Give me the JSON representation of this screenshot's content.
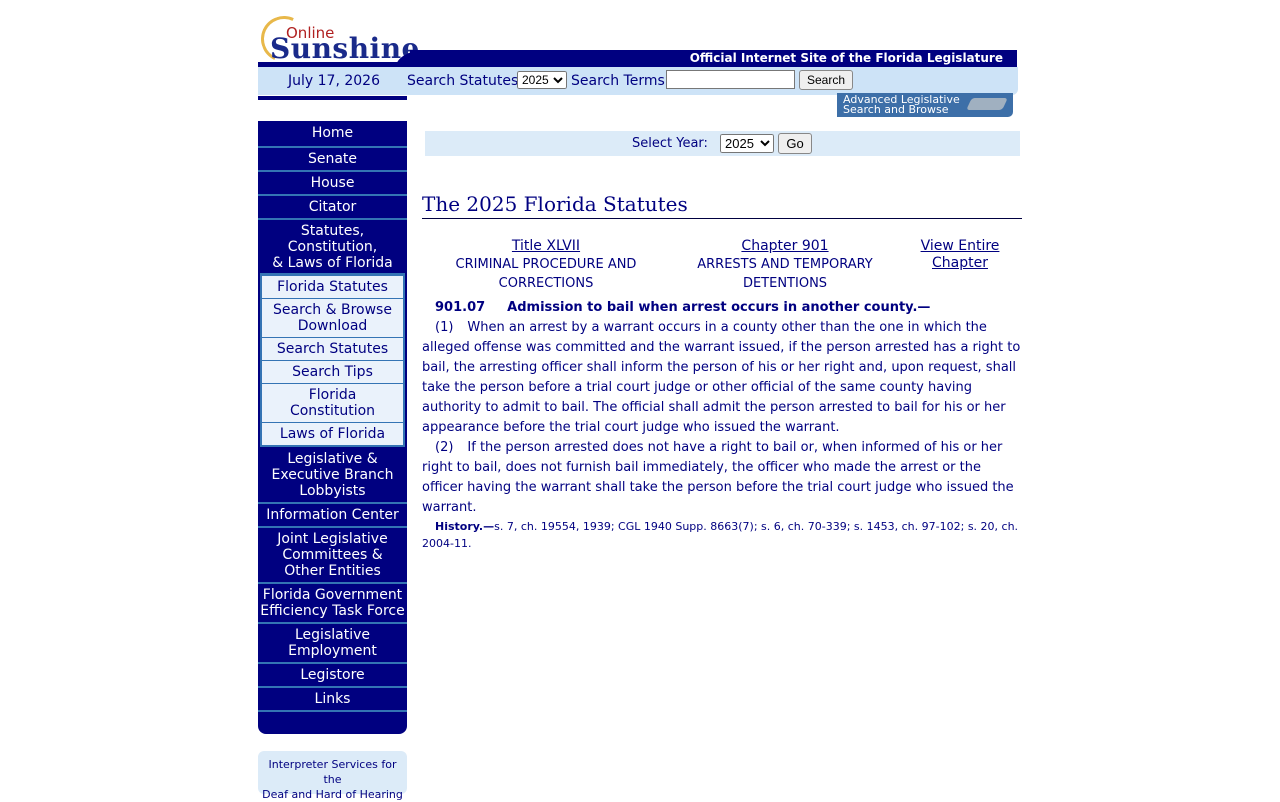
{
  "header": {
    "logo_top": "Online",
    "logo_main": "Sunshine",
    "banner": "Official Internet Site of the Florida Legislature",
    "date": "July 17, 2026",
    "search_statutes_label": "Search Statutes:",
    "search_year": "2025",
    "search_terms_label": "Search Terms:",
    "search_terms_value": "",
    "search_button": "Search",
    "advanced_line1": "Advanced Legislative",
    "advanced_line2": "Search and Browse"
  },
  "nav": {
    "items_top": [
      {
        "label": "Home"
      },
      {
        "label": "Senate"
      },
      {
        "label": "House"
      },
      {
        "label": "Citator"
      }
    ],
    "statutes_lines": [
      "Statutes,",
      "Constitution,",
      "& Laws of Florida"
    ],
    "sub_items": [
      {
        "lines": [
          "Florida Statutes"
        ]
      },
      {
        "lines": [
          "Search & Browse",
          "Download"
        ]
      },
      {
        "lines": [
          "Search Statutes"
        ]
      },
      {
        "lines": [
          "Search Tips"
        ]
      },
      {
        "lines": [
          "Florida",
          "Constitution"
        ]
      },
      {
        "lines": [
          "Laws of Florida"
        ]
      }
    ],
    "items_bottom": [
      {
        "lines": [
          "Legislative &",
          "Executive Branch",
          "Lobbyists"
        ]
      },
      {
        "lines": [
          "Information Center"
        ]
      },
      {
        "lines": [
          "Joint Legislative",
          "Committees &",
          "Other Entities"
        ]
      },
      {
        "lines": [
          "Florida Government",
          "Efficiency Task Force"
        ]
      },
      {
        "lines": [
          "Legislative",
          "Employment"
        ]
      },
      {
        "lines": [
          "Legistore"
        ]
      },
      {
        "lines": [
          "Links"
        ]
      }
    ]
  },
  "interpreter": {
    "line1": "Interpreter Services for the",
    "line2": "Deaf and Hard of Hearing"
  },
  "year_select": {
    "label": "Select Year:",
    "value": "2025",
    "go": "Go"
  },
  "page_title": "The 2025 Florida Statutes",
  "breadcrumbs": {
    "title_link": "Title XLVII",
    "title_desc_1": "CRIMINAL PROCEDURE AND",
    "title_desc_2": "CORRECTIONS",
    "chapter_link": "Chapter 901",
    "chapter_desc_1": "ARRESTS AND TEMPORARY",
    "chapter_desc_2": "DETENTIONS",
    "view_1": "View Entire",
    "view_2": "Chapter"
  },
  "section": {
    "number": "901.07",
    "catchline": "Admission to bail when arrest occurs in another county.—",
    "subsections": [
      {
        "num": "(1)",
        "text": "When an arrest by a warrant occurs in a county other than the one in which the alleged offense was committed and the warrant issued, if the person arrested has a right to bail, the arresting officer shall inform the person of his or her right and, upon request, shall take the person before a trial court judge or other official of the same county having authority to admit to bail. The official shall admit the person arrested to bail for his or her appearance before the trial court judge who issued the warrant."
      },
      {
        "num": "(2)",
        "text": "If the person arrested does not have a right to bail or, when informed of his or her right to bail, does not furnish bail immediately, the officer who made the arrest or the officer having the warrant shall take the person before the trial court judge who issued the warrant."
      }
    ],
    "history_label": "History.—",
    "history_text": "s. 7, ch. 19554, 1939; CGL 1940 Supp. 8663(7); s. 6, ch. 70-339; s. 1453, ch. 97-102; s. 20, ch. 2004-11."
  },
  "colors": {
    "navy": "#000080",
    "light_blue": "#cde3f7",
    "divider_blue": "#3474b4"
  }
}
